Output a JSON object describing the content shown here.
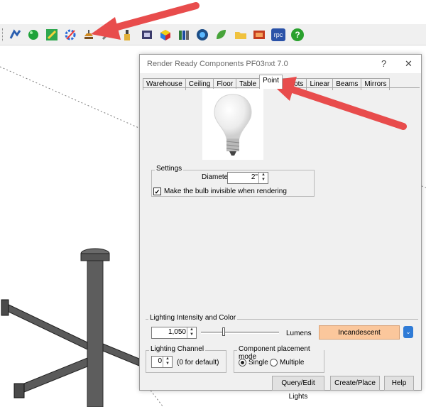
{
  "toolbar": {
    "icons": [
      "pipe-icon",
      "sphere-icon",
      "pencil-icon",
      "gear-icon",
      "lamp-icon",
      "brush-icon",
      "bottle-icon",
      "scanner-icon",
      "cube-icon",
      "books-icon",
      "lens-icon",
      "leaf-icon",
      "folder-icon",
      "film-icon",
      "rpc-icon",
      "help-icon"
    ],
    "rpc_label": "rpc",
    "help_label": "?"
  },
  "dialog": {
    "title": "Render Ready Components PF03nxt 7.0",
    "help_glyph": "?",
    "close_glyph": "✕",
    "tabs": [
      "Warehouse",
      "Ceiling",
      "Floor",
      "Table",
      "Point",
      "Spots",
      "Linear",
      "Beams",
      "Mirrors"
    ],
    "active_tab": "Point",
    "settings": {
      "label": "Settings",
      "diameter_label": "Diameter",
      "diameter_value": "2\"",
      "invisible_checked": true,
      "invisible_label": "Make the bulb invisible when rendering"
    },
    "lighting": {
      "label": "Lighting Intensity and Color",
      "value": "1,050",
      "units": "Lumens",
      "color_button": "Incandescent",
      "accent": "#fbc79c"
    },
    "channel": {
      "label": "Lighting Channel",
      "value": "0",
      "hint": "(0 for default)"
    },
    "placement": {
      "label": "Component placement mode",
      "single": "Single",
      "multiple": "Multiple",
      "selected": "Single"
    },
    "buttons": {
      "query": "Query/Edit Lights",
      "create": "Create/Place",
      "help": "Help"
    }
  },
  "colors": {
    "arrow": "#e84c4c",
    "dropdown_blue": "#2f7bd6"
  }
}
